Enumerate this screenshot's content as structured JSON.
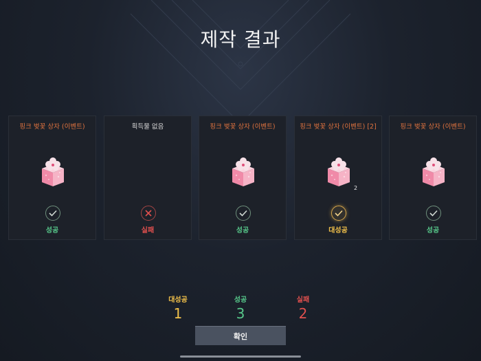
{
  "title": "제작 결과",
  "cards": [
    {
      "name": "핑크 벚꽃 상자 (이벤트)",
      "has_item": true,
      "quantity": "",
      "status": "ok",
      "status_label": "성공"
    },
    {
      "name": "획득물 없음",
      "has_item": false,
      "quantity": "",
      "status": "fail",
      "status_label": "실패"
    },
    {
      "name": "핑크 벚꽃 상자 (이벤트)",
      "has_item": true,
      "quantity": "",
      "status": "ok",
      "status_label": "성공"
    },
    {
      "name": "핑크 벚꽃 상자 (이벤트) [2]",
      "has_item": true,
      "quantity": "2",
      "status": "great",
      "status_label": "대성공"
    },
    {
      "name": "핑크 벚꽃 상자 (이벤트)",
      "has_item": true,
      "quantity": "",
      "status": "ok",
      "status_label": "성공"
    }
  ],
  "summary": {
    "great_label": "대성공",
    "great_value": "1",
    "ok_label": "성공",
    "ok_value": "3",
    "fail_label": "실패",
    "fail_value": "2"
  },
  "confirm_label": "확인",
  "colors": {
    "success": "#57c88a",
    "fail": "#e0504e",
    "great_success": "#f2c14a",
    "item_name": "#e0733f"
  }
}
